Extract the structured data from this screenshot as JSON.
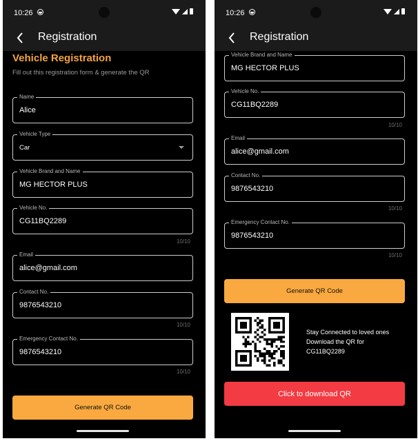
{
  "status": {
    "time": "10:26"
  },
  "app_bar": {
    "title": "Registration"
  },
  "form": {
    "heading": "Vehicle Registration",
    "subheading": "Fill out this registration form & generate the QR",
    "fields": {
      "name": {
        "label": "Name",
        "value": "Alice"
      },
      "vehicle_type": {
        "label": "Vehicle Type",
        "value": "Car"
      },
      "brand": {
        "label": "Vehicle Brand and Name",
        "value": "MG HECTOR PLUS"
      },
      "vehicle_no": {
        "label": "Vehicle No.",
        "value": "CG11BQ2289",
        "counter": "10/10"
      },
      "email": {
        "label": "Email",
        "value": "alice@gmail.com"
      },
      "contact": {
        "label": "Contact No.",
        "value": "9876543210",
        "counter": "10/10"
      },
      "emergency": {
        "label": "Emergency Contact No.",
        "value": "9876543210",
        "counter": "10/10"
      }
    },
    "generate_label": "Generate QR Code"
  },
  "qr": {
    "line1": "Stay Connected to loved ones",
    "line2": "Download the QR for",
    "line3": "CG11BQ2289",
    "download_label": "Click to download QR"
  },
  "colors": {
    "accent": "#f4a340",
    "button": "#f9a93f",
    "danger": "#f23b43"
  }
}
